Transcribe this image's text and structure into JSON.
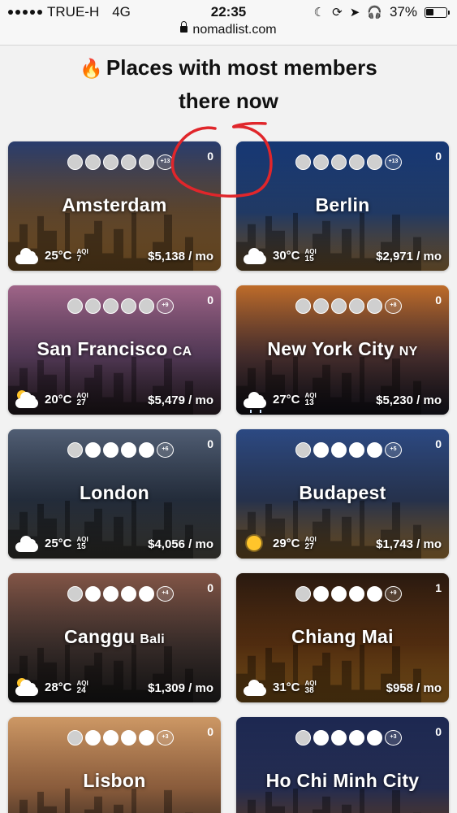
{
  "status_bar": {
    "carrier": "TRUE-H",
    "network": "4G",
    "time": "22:35",
    "url": "nomadlist.com",
    "battery": "37%",
    "battery_level": 0.37
  },
  "heading": {
    "icon": "fire-icon",
    "line1": "Places with most members",
    "line2": "there now"
  },
  "cards": [
    {
      "city": "Amsterdam",
      "region": "",
      "count": "0",
      "more": "+13",
      "temp": "25°C",
      "aqi_label": "AQI",
      "aqi": "7",
      "price": "$5,138 / mo",
      "weather": "cloud",
      "colors": [
        "#2a3f73",
        "#7a5a3a",
        "#c98b3e"
      ]
    },
    {
      "city": "Berlin",
      "region": "",
      "count": "0",
      "more": "+13",
      "temp": "30°C",
      "aqi_label": "AQI",
      "aqi": "15",
      "price": "$2,971 / mo",
      "weather": "cloud",
      "colors": [
        "#173a7a",
        "#2b4c85",
        "#b88a4c"
      ]
    },
    {
      "city": "San Francisco",
      "region": "CA",
      "count": "0",
      "more": "+9",
      "temp": "20°C",
      "aqi_label": "AQI",
      "aqi": "27",
      "price": "$5,479 / mo",
      "weather": "sun-cloud",
      "colors": [
        "#a86a8f",
        "#6b4a70",
        "#3a2b33"
      ]
    },
    {
      "city": "New York City",
      "region": "NY",
      "count": "0",
      "more": "+8",
      "temp": "27°C",
      "aqi_label": "AQI",
      "aqi": "13",
      "price": "$5,230 / mo",
      "weather": "rain",
      "colors": [
        "#c9722c",
        "#5a3b3a",
        "#1f1d2a"
      ]
    },
    {
      "city": "London",
      "region": "",
      "count": "0",
      "more": "+6",
      "temp": "25°C",
      "aqi_label": "AQI",
      "aqi": "15",
      "price": "$4,056 / mo",
      "weather": "cloud",
      "colors": [
        "#55637a",
        "#2e3a4d",
        "#5c5a52"
      ]
    },
    {
      "city": "Budapest",
      "region": "",
      "count": "0",
      "more": "+5",
      "temp": "29°C",
      "aqi_label": "AQI",
      "aqi": "27",
      "price": "$1,743 / mo",
      "weather": "sun",
      "colors": [
        "#2e4d8a",
        "#324265",
        "#c79144"
      ]
    },
    {
      "city": "Canggu",
      "region": "Bali",
      "count": "0",
      "more": "+4",
      "temp": "28°C",
      "aqi_label": "AQI",
      "aqi": "24",
      "price": "$1,309 / mo",
      "weather": "sun-cloud",
      "colors": [
        "#8a5a4a",
        "#4a3a36",
        "#2c2a2a"
      ]
    },
    {
      "city": "Chiang Mai",
      "region": "",
      "count": "1",
      "more": "+9",
      "temp": "31°C",
      "aqi_label": "AQI",
      "aqi": "38",
      "price": "$958 / mo",
      "weather": "cloud",
      "colors": [
        "#2b1a10",
        "#6a3a14",
        "#d08a2a"
      ]
    },
    {
      "city": "Lisbon",
      "region": "",
      "count": "0",
      "more": "+3",
      "temp": "",
      "aqi_label": "",
      "aqi": "",
      "price": "",
      "weather": "",
      "colors": [
        "#d8a06a",
        "#b77a4f",
        "#7a5a45"
      ]
    },
    {
      "city": "Ho Chi Minh City",
      "region": "",
      "count": "0",
      "more": "+3",
      "temp": "",
      "aqi_label": "",
      "aqi": "",
      "price": "",
      "weather": "",
      "colors": [
        "#1e2a55",
        "#2f3a6a",
        "#b07040"
      ]
    }
  ]
}
